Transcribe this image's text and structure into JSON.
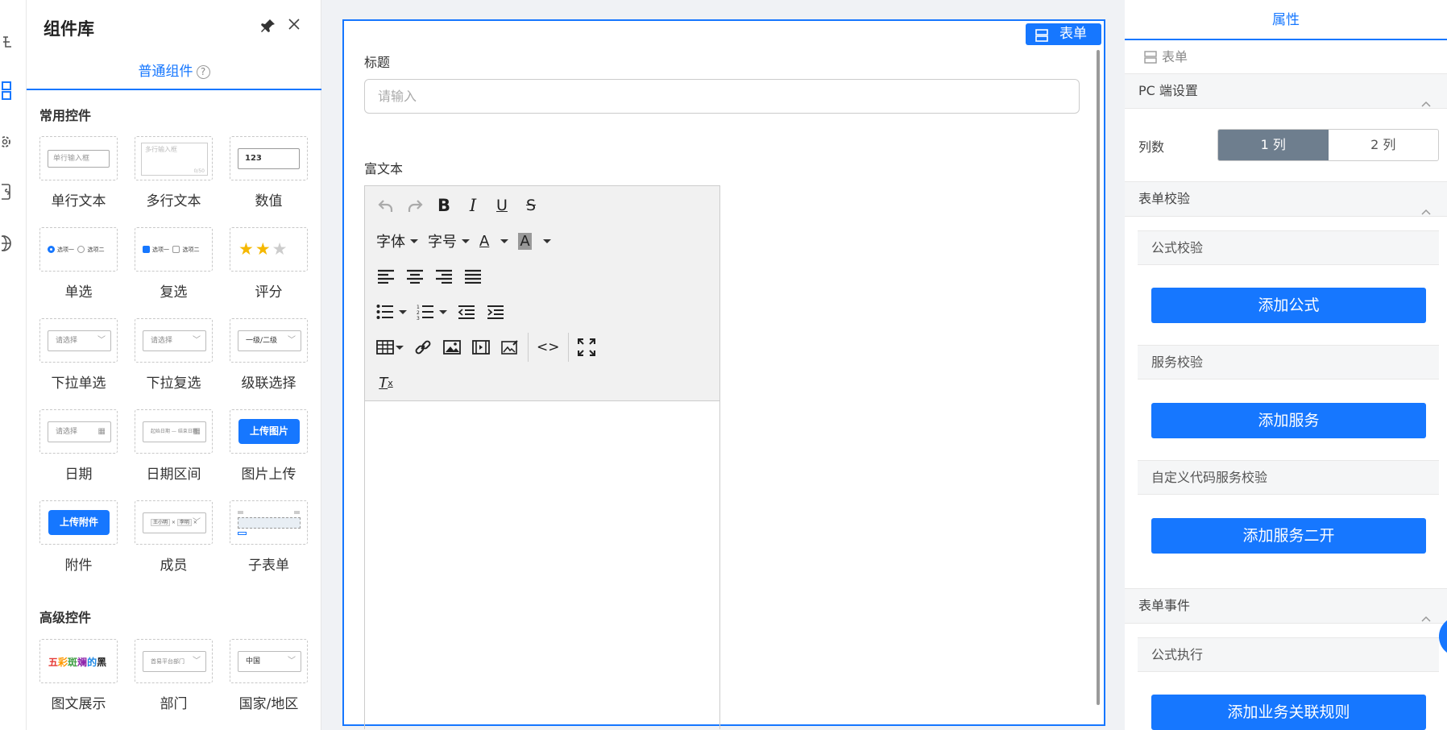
{
  "colors": {
    "accent": "#1677ff",
    "segment_active": "#6e7e8e"
  },
  "rail": {
    "icons": [
      "tree-icon",
      "component-icon",
      "gear-icon",
      "script-icon",
      "globe-icon"
    ]
  },
  "library": {
    "title": "组件库",
    "tab_label": "普通组件",
    "tab_help": "?",
    "common_title": "常用控件",
    "advanced_title": "高级控件",
    "items": [
      {
        "label": "单行文本",
        "preview": "单行输入框"
      },
      {
        "label": "多行文本",
        "preview": "多行输入框",
        "counter": "0/50"
      },
      {
        "label": "数值",
        "preview": "123"
      },
      {
        "label": "单选",
        "opt1": "选项一",
        "opt2": "选项二"
      },
      {
        "label": "复选",
        "opt1": "选项一",
        "opt2": "选项二"
      },
      {
        "label": "评分",
        "stars": "★★★"
      },
      {
        "label": "下拉单选",
        "preview": "请选择"
      },
      {
        "label": "下拉复选",
        "preview": "请选择"
      },
      {
        "label": "级联选择",
        "preview": "一级/二级"
      },
      {
        "label": "日期",
        "preview": "请选择"
      },
      {
        "label": "日期区间",
        "preview": "起始日期 — 结束日期"
      },
      {
        "label": "图片上传",
        "preview": "上传图片"
      },
      {
        "label": "附件",
        "preview": "上传附件"
      },
      {
        "label": "成员",
        "tag1": "王小明",
        "tag2": "李明"
      },
      {
        "label": "子表单"
      }
    ],
    "advanced": [
      {
        "label": "图文展示",
        "preview": "五彩斑斓的黑"
      },
      {
        "label": "部门",
        "preview": "首易平台部门"
      },
      {
        "label": "国家/地区",
        "preview": "中国"
      }
    ]
  },
  "canvas": {
    "tag": "表单",
    "title_label": "标题",
    "title_placeholder": "请输入",
    "richtext_label": "富文本",
    "toolbar": {
      "font": "字体",
      "size": "字号",
      "color_a": "A",
      "bg_a": "A",
      "clear": "T"
    }
  },
  "props": {
    "tab": "属性",
    "crumb": "表单",
    "pc_title": "PC 端设置",
    "cols_label": "列数",
    "cols": [
      "1 列",
      "2 列"
    ],
    "cols_selected": "1 列",
    "validate_title": "表单校验",
    "formula_head": "公式校验",
    "formula_btn": "添加公式",
    "service_head": "服务校验",
    "service_btn": "添加服务",
    "custom_head": "自定义代码服务校验",
    "custom_btn": "添加服务二开",
    "event_title": "表单事件",
    "exec_head": "公式执行",
    "exec_btn": "添加业务关联规则"
  }
}
